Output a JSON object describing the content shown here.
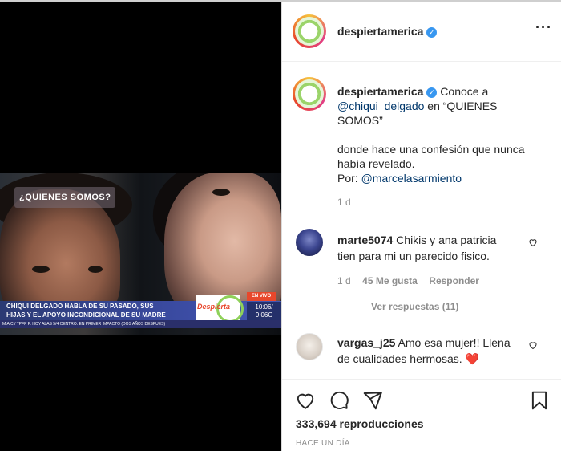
{
  "post": {
    "author": "despiertamerica",
    "verified_mark": "✓",
    "more_icon": "more-icon",
    "caption": {
      "lead": "Conoce a",
      "mention1": "@chiqui_delgado",
      "mid": "en “QUIENES SOMOS”",
      "line2": "donde hace una confesión que nunca había revelado.",
      "by": "Por:",
      "mention2": "@marcelasarmiento",
      "time": "1 d"
    },
    "video_overlay": {
      "show_badge": "¿QUIENES SOMOS?",
      "live": "EN VIVO",
      "headline_1": "CHIQUI DELGADO HABLA DE SU PASADO, SUS",
      "headline_2": "HIJAS Y EL APOYO INCONDICIONAL DE SU MADRE",
      "logo": "Despierta",
      "clock_1": "10:06/",
      "clock_2": "9:06C",
      "ticker": "MIA C / TPFP P. HOY ALAS 5/4 CENTRO. EN PRIMER IMPACTO (DOS AÑOS DESPUES)"
    }
  },
  "comments": [
    {
      "user": "marte5074",
      "text_1": "Chikis y ana patricia",
      "text_2": "tien para mi un parecido fisico.",
      "time": "1 d",
      "likes": "45 Me gusta",
      "reply": "Responder",
      "view_replies": "Ver respuestas (11)"
    },
    {
      "user": "vargas_j25",
      "text_1": "Amo esa mujer!! Llena",
      "text_2": "de cualidades hermosas.",
      "emoji": "❤️"
    }
  ],
  "footer": {
    "views": "333,694 reproducciones",
    "time": "HACE UN DÍA"
  },
  "colors": {
    "link": "#00376b",
    "verified": "#3897f0",
    "muted": "#8e8e8e",
    "heart": "#ed4956"
  }
}
